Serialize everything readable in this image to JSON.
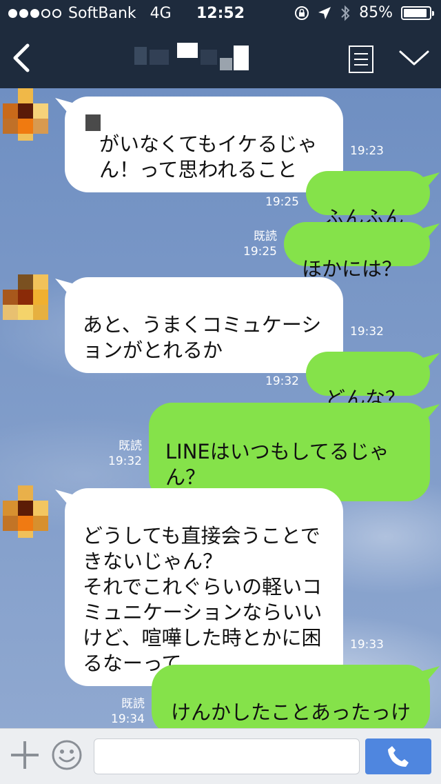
{
  "status_bar": {
    "carrier": "SoftBank",
    "network": "4G",
    "time": "12:52",
    "battery": "85%",
    "signal_bars": 3,
    "signal_total": 5
  },
  "header": {
    "back_icon": "back-chevron-icon",
    "menu_icon": "menu-icon",
    "collapse_icon": "chevron-down-icon"
  },
  "colors": {
    "header_bg": "#1e2b3d",
    "bubble_in": "#ffffff",
    "bubble_out": "#85e24a",
    "send_button": "#4f86df"
  },
  "messages": [
    {
      "dir": "in",
      "text": "がいなくてもイケるじゃん！って思われること",
      "time": "19:23"
    },
    {
      "dir": "out",
      "text": "ふんふん",
      "read": "既読",
      "time": "19:25"
    },
    {
      "dir": "out",
      "text": "ほかには？",
      "read": "既読",
      "time": "19:25"
    },
    {
      "dir": "in",
      "text": "あと、うまくコミュケーションがとれるか",
      "time": "19:32"
    },
    {
      "dir": "out",
      "text": "どんな？",
      "read": "既読",
      "time": "19:32"
    },
    {
      "dir": "out",
      "text": "LINEはいつもしてるじゃん？",
      "read": "既読",
      "time": "19:32"
    },
    {
      "dir": "in",
      "text": "どうしても直接会うことできないじゃん？\nそれでこれぐらいの軽いコミュニケーションならいいけど、喧嘩した時とかに困るなーって",
      "time": "19:33"
    },
    {
      "dir": "out",
      "text": "けんかしたことあったっけ",
      "read": "既読",
      "time": "19:34"
    }
  ],
  "input_bar": {
    "placeholder": "",
    "plus_icon": "plus-icon",
    "emoji_icon": "smiley-icon",
    "call_icon": "phone-icon"
  }
}
